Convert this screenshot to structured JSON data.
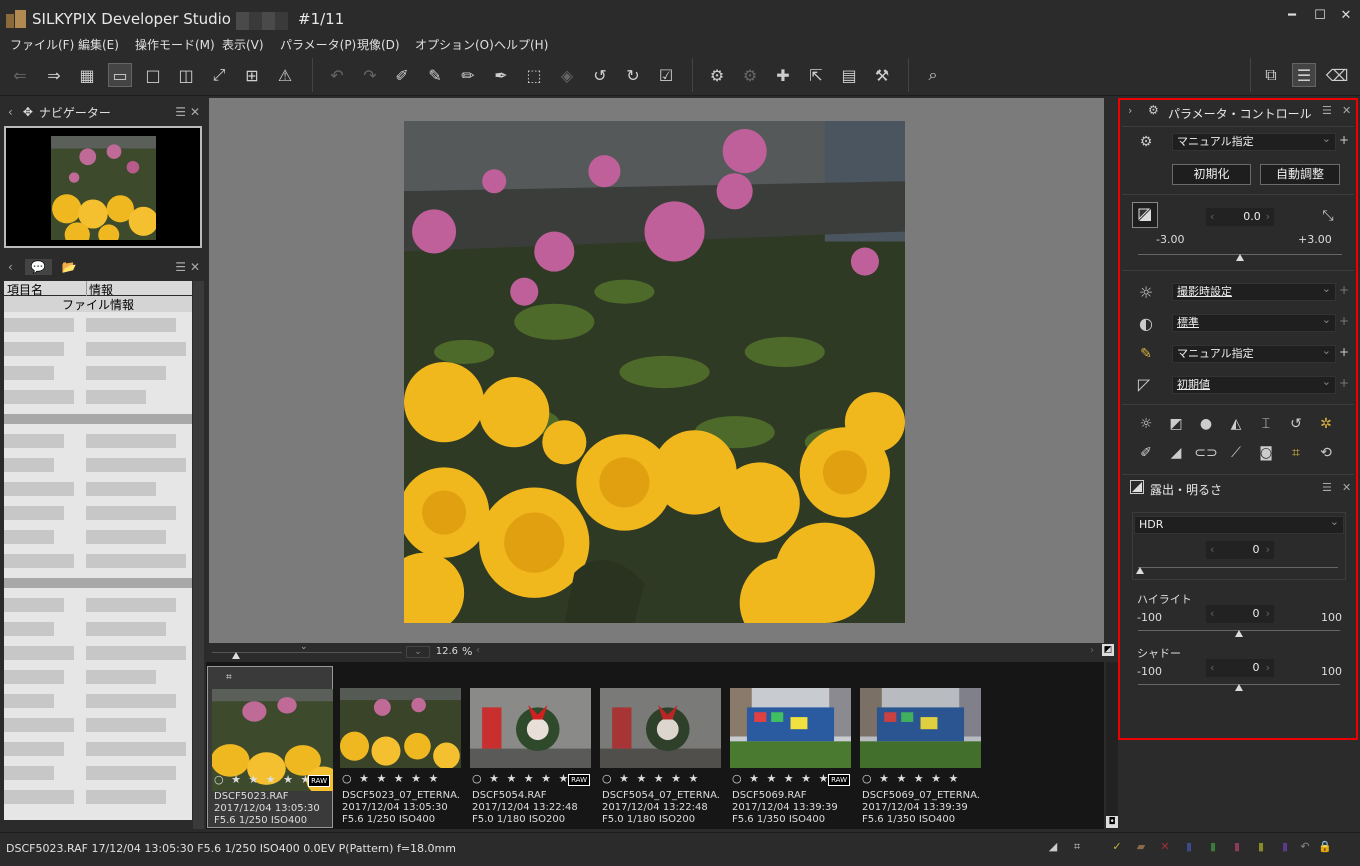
{
  "window": {
    "title": "SILKYPIX Developer Studio P",
    "counter": "#1/11"
  },
  "menu": [
    "ファイル(F)",
    "編集(E)",
    "操作モード(M)",
    "表示(V)",
    "パラメータ(P)",
    "現像(D)",
    "オプション(O)",
    "ヘルプ(H)"
  ],
  "navigator": {
    "title": "ナビゲーター"
  },
  "info_panel": {
    "col_item": "項目名",
    "col_info": "情報",
    "section": "ファイル情報"
  },
  "viewer": {
    "zoom": "12.6",
    "zoom_unit": "%"
  },
  "filmstrip": [
    {
      "name": "DSCF5023.RAF",
      "date": "2017/12/04 13:05:30",
      "exif": "F5.6 1/250 ISO400",
      "raw": true,
      "selected": true
    },
    {
      "name": "DSCF5023_07_ETERNA.",
      "date": "2017/12/04 13:05:30",
      "exif": "F5.6 1/250 ISO400",
      "raw": false,
      "selected": false
    },
    {
      "name": "DSCF5054.RAF",
      "date": "2017/12/04 13:22:48",
      "exif": "F5.0 1/180 ISO200",
      "raw": true,
      "selected": false
    },
    {
      "name": "DSCF5054_07_ETERNA.",
      "date": "2017/12/04 13:22:48",
      "exif": "F5.0 1/180 ISO200",
      "raw": false,
      "selected": false
    },
    {
      "name": "DSCF5069.RAF",
      "date": "2017/12/04 13:39:39",
      "exif": "F5.6 1/350 ISO400",
      "raw": true,
      "selected": false
    },
    {
      "name": "DSCF5069_07_ETERNA.",
      "date": "2017/12/04 13:39:39",
      "exif": "F5.6 1/350 ISO400",
      "raw": false,
      "selected": false
    }
  ],
  "film_stars": "○ ★ ★ ★ ★ ★",
  "raw_label": "RAW",
  "param": {
    "title": "パラメータ・コントロール",
    "taste": "マニュアル指定",
    "reset_button": "初期化",
    "auto_button": "自動調整",
    "exposure_value": "0.0",
    "exposure_min": "-3.00",
    "exposure_max": "+3.00",
    "white_balance": "撮影時設定",
    "tone": "標準",
    "color": "マニュアル指定",
    "sharpness": "初期値"
  },
  "exposure_panel": {
    "title": "露出・明るさ",
    "mode": "HDR",
    "hdr_value": "0",
    "highlight_label": "ハイライト",
    "highlight_min": "-100",
    "highlight_max": "100",
    "highlight_value": "0",
    "shadow_label": "シャドー",
    "shadow_min": "-100",
    "shadow_max": "100",
    "shadow_value": "0"
  },
  "status": "DSCF5023.RAF 17/12/04 13:05:30 F5.6 1/250 ISO400  0.0EV P(Pattern) f=18.0mm"
}
